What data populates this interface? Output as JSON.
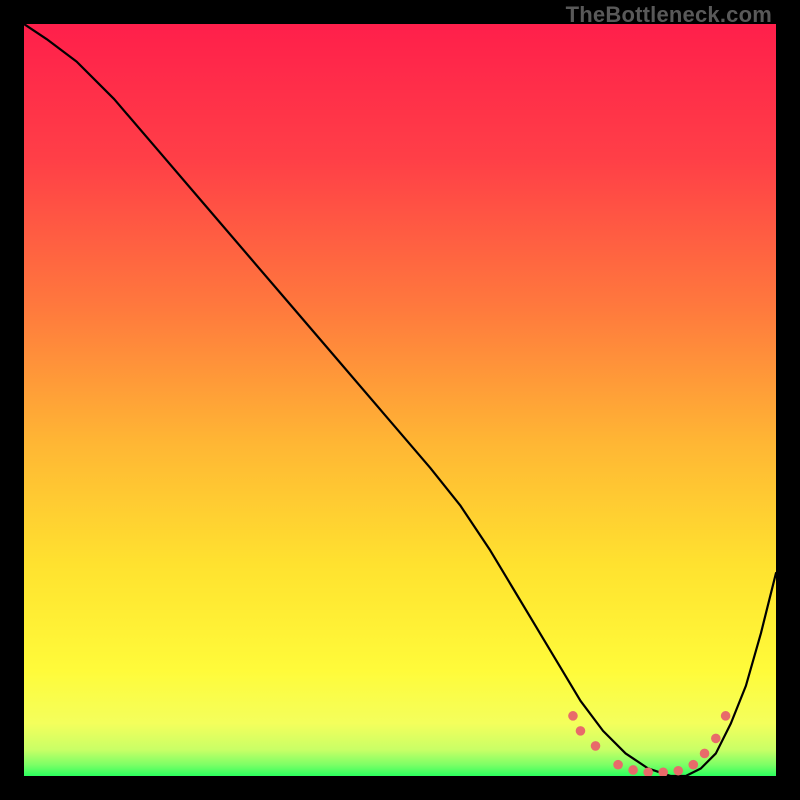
{
  "watermark": "TheBottleneck.com",
  "chart_data": {
    "type": "line",
    "title": "",
    "xlabel": "",
    "ylabel": "",
    "xlim": [
      0,
      100
    ],
    "ylim": [
      0,
      100
    ],
    "gradient": {
      "stops": [
        {
          "offset": 0.0,
          "color": "#ff1f4b"
        },
        {
          "offset": 0.18,
          "color": "#ff3f47"
        },
        {
          "offset": 0.38,
          "color": "#ff7a3d"
        },
        {
          "offset": 0.56,
          "color": "#ffb734"
        },
        {
          "offset": 0.72,
          "color": "#ffe22f"
        },
        {
          "offset": 0.86,
          "color": "#fffb3a"
        },
        {
          "offset": 0.93,
          "color": "#f4ff5c"
        },
        {
          "offset": 0.965,
          "color": "#c9ff66"
        },
        {
          "offset": 0.985,
          "color": "#7dff66"
        },
        {
          "offset": 1.0,
          "color": "#2bff5e"
        }
      ]
    },
    "series": [
      {
        "name": "bottleneck-curve",
        "color": "#000000",
        "x": [
          0,
          3,
          7,
          12,
          18,
          24,
          30,
          36,
          42,
          48,
          54,
          58,
          62,
          65,
          68,
          71,
          74,
          77,
          80,
          83,
          86,
          88,
          90,
          92,
          94,
          96,
          98,
          100
        ],
        "y": [
          100,
          98,
          95,
          90,
          83,
          76,
          69,
          62,
          55,
          48,
          41,
          36,
          30,
          25,
          20,
          15,
          10,
          6,
          3,
          1,
          0,
          0,
          1,
          3,
          7,
          12,
          19,
          27
        ]
      }
    ],
    "markers": {
      "name": "flat-region-markers",
      "color": "#e86a6a",
      "points": [
        {
          "x": 73,
          "y": 8
        },
        {
          "x": 74,
          "y": 6
        },
        {
          "x": 76,
          "y": 4
        },
        {
          "x": 79,
          "y": 1.5
        },
        {
          "x": 81,
          "y": 0.8
        },
        {
          "x": 83,
          "y": 0.5
        },
        {
          "x": 85,
          "y": 0.5
        },
        {
          "x": 87,
          "y": 0.7
        },
        {
          "x": 89,
          "y": 1.5
        },
        {
          "x": 90.5,
          "y": 3
        },
        {
          "x": 92,
          "y": 5
        },
        {
          "x": 93.3,
          "y": 8
        }
      ]
    }
  }
}
